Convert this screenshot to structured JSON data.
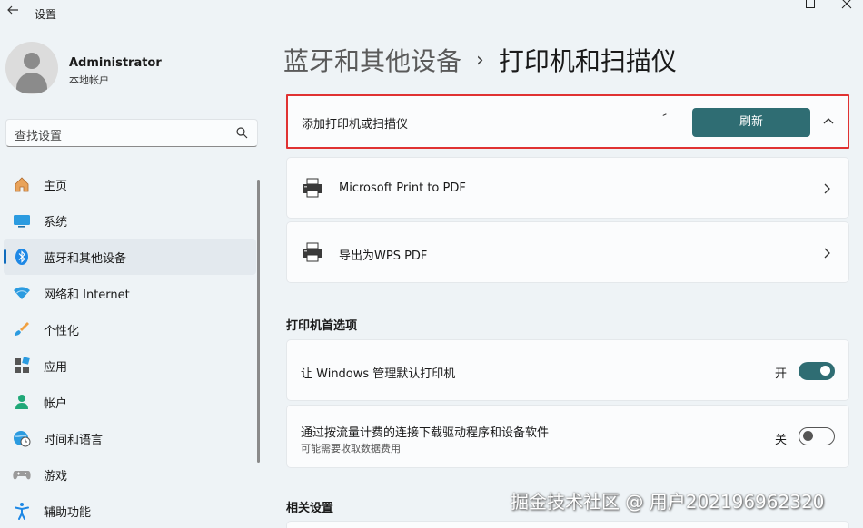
{
  "window": {
    "title": "设置"
  },
  "profile": {
    "name": "Administrator",
    "account_type": "本地帐户"
  },
  "search": {
    "placeholder": "查找设置"
  },
  "sidebar": {
    "items": [
      {
        "label": "主页",
        "icon": "home-icon"
      },
      {
        "label": "系统",
        "icon": "system-icon"
      },
      {
        "label": "蓝牙和其他设备",
        "icon": "bluetooth-icon",
        "active": true
      },
      {
        "label": "网络和 Internet",
        "icon": "wifi-icon"
      },
      {
        "label": "个性化",
        "icon": "brush-icon"
      },
      {
        "label": "应用",
        "icon": "apps-icon"
      },
      {
        "label": "帐户",
        "icon": "account-icon"
      },
      {
        "label": "时间和语言",
        "icon": "globe-clock-icon"
      },
      {
        "label": "游戏",
        "icon": "gamepad-icon"
      },
      {
        "label": "辅助功能",
        "icon": "accessibility-icon"
      }
    ]
  },
  "header": {
    "parent": "蓝牙和其他设备",
    "separator": "›",
    "current": "打印机和扫描仪"
  },
  "add_device": {
    "label": "添加打印机或扫描仪",
    "button": "刷新"
  },
  "printers": [
    {
      "name": "Microsoft Print to PDF",
      "icon": "printer-icon"
    },
    {
      "name": "导出为WPS PDF",
      "icon": "printer-icon"
    }
  ],
  "preferences": {
    "title": "打印机首选项",
    "options": [
      {
        "label": "让 Windows 管理默认打印机",
        "state": "开",
        "on": true
      },
      {
        "label": "通过按流量计费的连接下载驱动程序和设备软件",
        "sub": "可能需要收取数据费用",
        "state": "关",
        "on": false
      }
    ]
  },
  "related": {
    "title": "相关设置"
  },
  "watermark": "掘金技术社区 @ 用户202196962320",
  "colors": {
    "accent": "#2f6d73",
    "highlight_border": "#e03232",
    "nav_indicator": "#0f6cbd"
  }
}
